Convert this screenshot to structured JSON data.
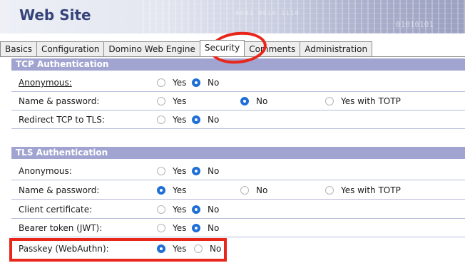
{
  "header": {
    "title": "Web Site",
    "deco_text": "01010101",
    "deco_text2": "0001 0010 1110"
  },
  "tabs": [
    {
      "label": "Basics",
      "active": false
    },
    {
      "label": "Configuration",
      "active": false
    },
    {
      "label": "Domino Web Engine",
      "active": false
    },
    {
      "label": "Security",
      "active": true
    },
    {
      "label": "Comments",
      "active": false
    },
    {
      "label": "Administration",
      "active": false
    }
  ],
  "tcp": {
    "header": "TCP Authentication",
    "rows": [
      {
        "label": "Anonymous:",
        "options": [
          "Yes",
          "No"
        ],
        "selected": "No"
      },
      {
        "label": "Name & password:",
        "options": [
          "Yes",
          "No",
          "Yes with TOTP"
        ],
        "selected": "No"
      },
      {
        "label": "Redirect TCP to TLS:",
        "options": [
          "Yes",
          "No"
        ],
        "selected": "No"
      }
    ]
  },
  "tls": {
    "header": "TLS Authentication",
    "rows": [
      {
        "label": "Anonymous:",
        "options": [
          "Yes",
          "No"
        ],
        "selected": "No"
      },
      {
        "label": "Name & password:",
        "options": [
          "Yes",
          "No",
          "Yes with TOTP"
        ],
        "selected": "Yes"
      },
      {
        "label": "Client certificate:",
        "options": [
          "Yes",
          "No"
        ],
        "selected": "No"
      },
      {
        "label": "Bearer token (JWT):",
        "options": [
          "Yes",
          "No"
        ],
        "selected": "No"
      },
      {
        "label": "Passkey (WebAuthn):",
        "options": [
          "Yes",
          "No"
        ],
        "selected": "Yes"
      }
    ]
  },
  "colors": {
    "section_header_bg": "#a1a4d0",
    "radio_selected": "#1f6fd6",
    "highlight_red": "#e8261a",
    "title_color": "#35437a"
  }
}
